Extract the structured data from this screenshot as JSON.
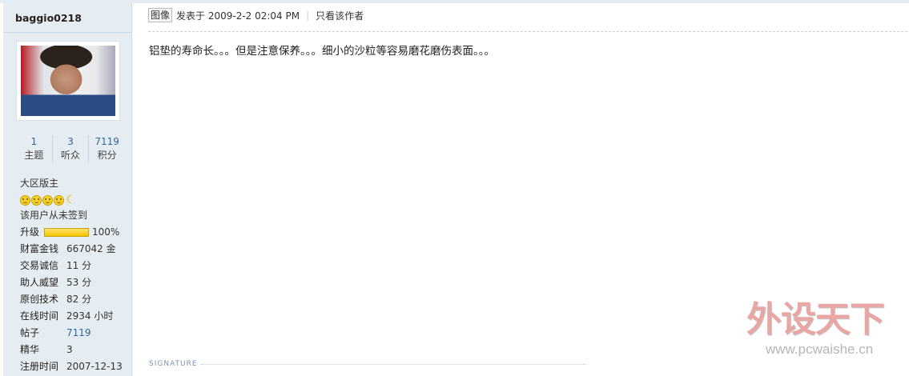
{
  "user": {
    "name": "baggio0218",
    "stats": [
      {
        "value": "1",
        "label": "主题"
      },
      {
        "value": "3",
        "label": "听众"
      },
      {
        "value": "7119",
        "label": "积分"
      }
    ],
    "rank": "大区版主",
    "level_icons": [
      "smile-icon",
      "smile-icon",
      "smile-icon",
      "smile-icon",
      "moon-icon"
    ],
    "moon_glyph": "☾",
    "checkin": "该用户从未签到",
    "upgrade": {
      "label": "升级",
      "percent_text": "100%",
      "fraction": 1.0
    },
    "fields": [
      {
        "key": "财富金钱",
        "value": "667042 金",
        "link": false
      },
      {
        "key": "交易诚信",
        "value": "11 分",
        "link": false
      },
      {
        "key": "助人威望",
        "value": "53 分",
        "link": false
      },
      {
        "key": "原创技术",
        "value": "82 分",
        "link": false
      },
      {
        "key": "在线时间",
        "value": "2934 小时",
        "link": false
      },
      {
        "key": "帖子",
        "value": "7119",
        "link": true
      },
      {
        "key": "精华",
        "value": "3",
        "link": false
      },
      {
        "key": "注册时间",
        "value": "2007-12-13",
        "link": false
      }
    ]
  },
  "post": {
    "avatar_toggle": "图像",
    "posted": "发表于 2009-2-2 02:04 PM",
    "separator": "|",
    "only_author": "只看该作者",
    "content": "铝垫的寿命长。。。但是注意保养。。。细小的沙粒等容易磨花磨伤表面。。。",
    "signature_label": "SIGNATURE"
  },
  "watermark": {
    "title": "外设天下",
    "url": "www.pcwaishe.cn"
  }
}
